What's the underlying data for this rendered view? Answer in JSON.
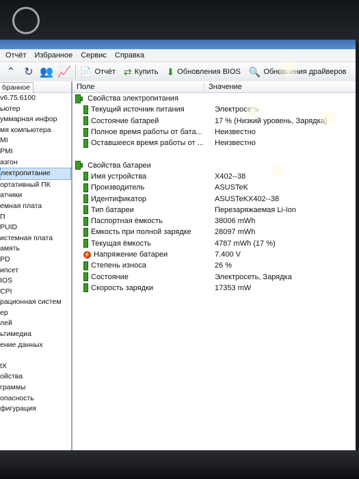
{
  "menu": [
    "Отчёт",
    "Избранное",
    "Сервис",
    "Справка"
  ],
  "toolbar": {
    "report_label": "Отчёт",
    "buy_label": "Купить",
    "bios_label": "Обновления BIOS",
    "drivers_label": "Обновления драйверов"
  },
  "sidebar": {
    "tab_label": "бранное",
    "items": [
      "v6.75.6100",
      "ьютер",
      "уммарная инфор",
      "мя компьютера",
      "MI",
      "PMI",
      "азгон",
      "лектропитание",
      "ортативный ПК",
      "атчики",
      "емная плата",
      "П",
      "PUID",
      "истемная плата",
      "амять",
      "PD",
      "ипсет",
      "IOS",
      "CPI",
      "рационная систем",
      "ер",
      "лей",
      "ьтимедиа",
      "ение данных",
      "",
      "tX",
      "ойства",
      "граммы",
      "опасность",
      "фигурация"
    ],
    "selected_index": 7
  },
  "columns": {
    "field": "Поле",
    "value": "Значение"
  },
  "power_group": {
    "title": "Свойства электропитания",
    "rows": [
      {
        "field": "Текущий источник питания",
        "value": "Электросеть"
      },
      {
        "field": "Состояние батарей",
        "value": "17 % (Низкий уровень, Зарядка)"
      },
      {
        "field": "Полное время работы от бата...",
        "value": "Неизвестно"
      },
      {
        "field": "Оставшееся время работы от ...",
        "value": "Неизвестно"
      }
    ]
  },
  "battery_group": {
    "title": "Свойства батареи",
    "rows": [
      {
        "field": "Имя устройства",
        "value": "X402--38",
        "icon": "battery-icon"
      },
      {
        "field": "Производитель",
        "value": "ASUSTeK",
        "icon": "battery-icon"
      },
      {
        "field": "Идентификатор",
        "value": "ASUSTeKX402--38",
        "icon": "battery-icon"
      },
      {
        "field": "Тип батареи",
        "value": "Перезаряжаемая Li-Ion",
        "icon": "battery-icon"
      },
      {
        "field": "Паспортная ёмкость",
        "value": "38006 mWh",
        "icon": "battery-icon"
      },
      {
        "field": "Ёмкость при полной зарядке",
        "value": "28097 mWh",
        "icon": "battery-icon"
      },
      {
        "field": "Текущая ёмкость",
        "value": "4787 mWh  (17 %)",
        "icon": "battery-icon"
      },
      {
        "field": "Напряжение батареи",
        "value": "7.400 V",
        "icon": "voltage-icon"
      },
      {
        "field": "Степень износа",
        "value": "26 %",
        "icon": "battery-icon"
      },
      {
        "field": "Состояние",
        "value": "Электросеть, Зарядка",
        "icon": "battery-icon"
      },
      {
        "field": "Скорость зарядки",
        "value": "17353 mW",
        "icon": "battery-icon"
      }
    ]
  },
  "colors": {
    "selection": "#cde3f7",
    "battery_icon": "#3d9a2a",
    "voltage_icon": "#d7372c",
    "title_strip": "#3d6fb2"
  }
}
